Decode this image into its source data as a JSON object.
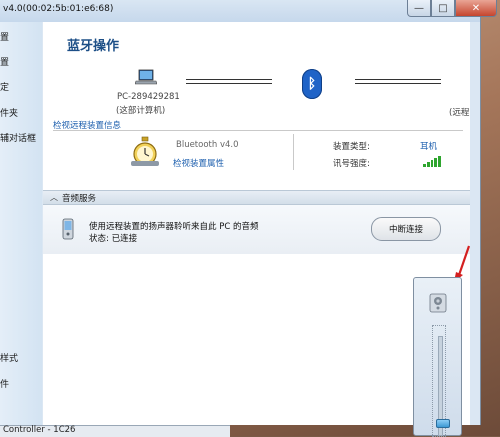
{
  "window": {
    "title": "v4.0(00:02:5b:01:e6:68)",
    "controls": {
      "minimize": "—",
      "maximize": "□",
      "close": "✕"
    }
  },
  "sidebar": {
    "items": [
      {
        "label": "置"
      },
      {
        "label": "置"
      },
      {
        "label": "定"
      },
      {
        "label": "件夹"
      },
      {
        "label": "辅对话框"
      },
      {
        "label": "样式"
      },
      {
        "label": "件"
      }
    ]
  },
  "main": {
    "title": "蓝牙操作",
    "local_pc": {
      "name": "PC-289429281",
      "sub": "(这部计算机)"
    },
    "remote_cut": "(远程",
    "view_remote_link": "检视远程装置信息",
    "device": {
      "name": "Bluetooth v4.0",
      "props_link": "检视装置属性",
      "type_label": "装置类型:",
      "type_value": "耳机",
      "signal_label": "讯号强度:",
      "signal_bars": 4
    }
  },
  "audio_service": {
    "section_label": "音频服务",
    "description": "使用远程装置的扬声器聆听来自此 PC 的音频",
    "status": "状态:   已连接",
    "disconnect_label": "中断连接"
  },
  "taskbar": {
    "text": "Controller - 1C26"
  },
  "volume": {
    "level": 0.1
  },
  "colors": {
    "accent": "#1d4f87",
    "link": "#1d5fae",
    "bluetooth": "#1f63c7",
    "signal": "#2ea52e",
    "arrow": "#d42020"
  }
}
